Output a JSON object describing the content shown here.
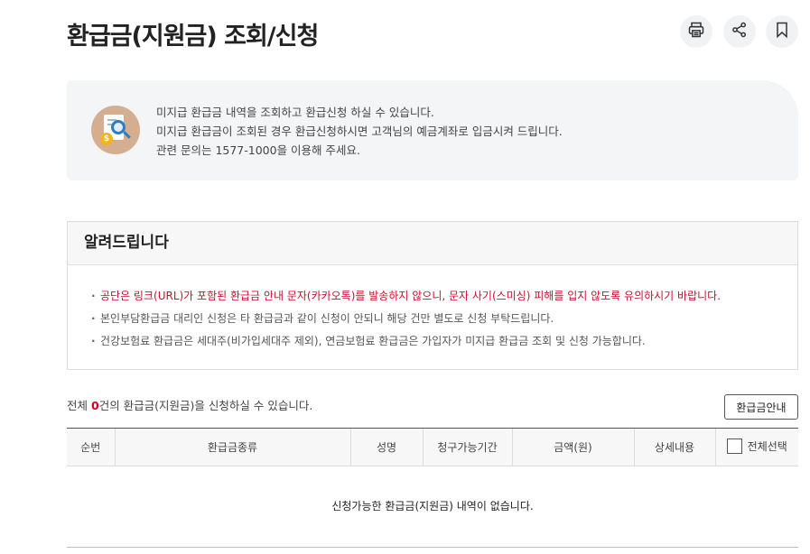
{
  "header": {
    "title": "환급금(지원금) 조회/신청",
    "actions": [
      {
        "name": "print-button",
        "icon": "printer-icon"
      },
      {
        "name": "share-button",
        "icon": "share-icon"
      },
      {
        "name": "bookmark-button",
        "icon": "bookmark-icon"
      }
    ]
  },
  "intro": {
    "icon": "search-document-coin-icon",
    "lines": [
      "미지급 환급금 내역을 조회하고 환급신청 하실 수 있습니다.",
      "미지급 환급금이 조회된 경우 환급신청하시면 고객님의 예금계좌로 입금시켜 드립니다.",
      "관련 문의는 1577-1000을 이용해 주세요."
    ]
  },
  "notice": {
    "title": "알려드립니다",
    "items": [
      "공단은 링크(URL)가 포함된 환급금 안내 문자(카카오톡)를 발송하지 않으니, 문자 사기(스미싱) 피해를 입지 않도록 유의하시기 바랍니다.",
      "본인부담환급금 대리인 신청은 타 환급금과 같이 신청이 안되니 해당 건만 별도로 신청 부탁드립니다.",
      "건강보험료 환급금은 세대주(비가입세대주 제외), 연금보험료 환급금은 가입자가 미지급 환급금 조회 및 신청 가능합니다."
    ]
  },
  "summary": {
    "prefix": "전체 ",
    "count": "0",
    "suffix": "건의 환급금(지원금)을 신청하실 수 있습니다."
  },
  "guide_button": "환급금안내",
  "table": {
    "columns": [
      "순번",
      "환급금종류",
      "성명",
      "청구가능기간",
      "금액(원)",
      "상세내용"
    ],
    "select_all_label": "전체선택",
    "empty_message": "신청가능한 환급금(지원금) 내역이 없습니다."
  },
  "colors": {
    "accent_red": "#c8102e",
    "count_red": "#d0021b",
    "intro_bg": "#f4f5f7",
    "icon_bg": "#d4ae8f"
  }
}
